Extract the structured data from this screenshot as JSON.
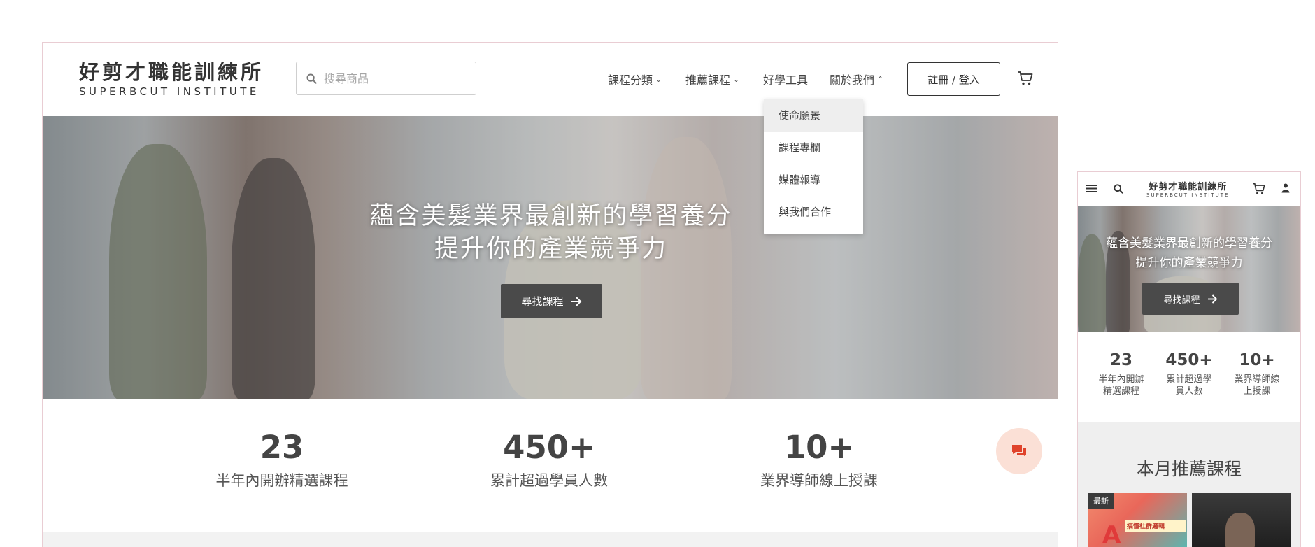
{
  "desktop": {
    "logo": {
      "zh": "好剪才職能訓練所",
      "en": "SUPERBCUT INSTITUTE"
    },
    "search": {
      "placeholder": "搜尋商品"
    },
    "nav": [
      {
        "label": "課程分類",
        "chevron": "chevron-down-icon"
      },
      {
        "label": "推薦課程",
        "chevron": "chevron-down-icon"
      },
      {
        "label": "好學工具"
      },
      {
        "label": "關於我們",
        "chevron": "chevron-up-icon"
      }
    ],
    "login_label": "註冊 / 登入",
    "dropdown": [
      "使命願景",
      "課程專欄",
      "媒體報導",
      "與我們合作"
    ],
    "hero": {
      "line1": "蘊含美髮業界最創新的學習養分",
      "line2": "提升你的產業競爭力",
      "button": "尋找課程"
    },
    "stats": [
      {
        "num": "23",
        "label": "半年內開辦精選課程"
      },
      {
        "num": "450+",
        "label": "累計超過學員人數"
      },
      {
        "num": "10+",
        "label": "業界導師線上授課"
      }
    ]
  },
  "mobile": {
    "logo": {
      "zh": "好剪才職能訓練所",
      "en": "SUPERBCUT INSTITUTE"
    },
    "hero": {
      "line1": "蘊含美髮業界最創新的學習養分",
      "line2": "提升你的產業競爭力",
      "button": "尋找課程"
    },
    "stats": [
      {
        "num": "23",
        "l1": "半年內開辦",
        "l2": "精選課程"
      },
      {
        "num": "450+",
        "l1": "累計超過學",
        "l2": "員人數"
      },
      {
        "num": "10+",
        "l1": "業界導師線",
        "l2": "上授課"
      }
    ],
    "rec_title": "本月推薦課程",
    "card_badge": "最新",
    "card_text": "搞懂社群邏輯"
  },
  "colors": {
    "chat_bubble": "#fbe0d6",
    "chat_icon": "#e0432b",
    "frame_border": "#e9cdd3",
    "button_dark": "#4a4a4a"
  }
}
